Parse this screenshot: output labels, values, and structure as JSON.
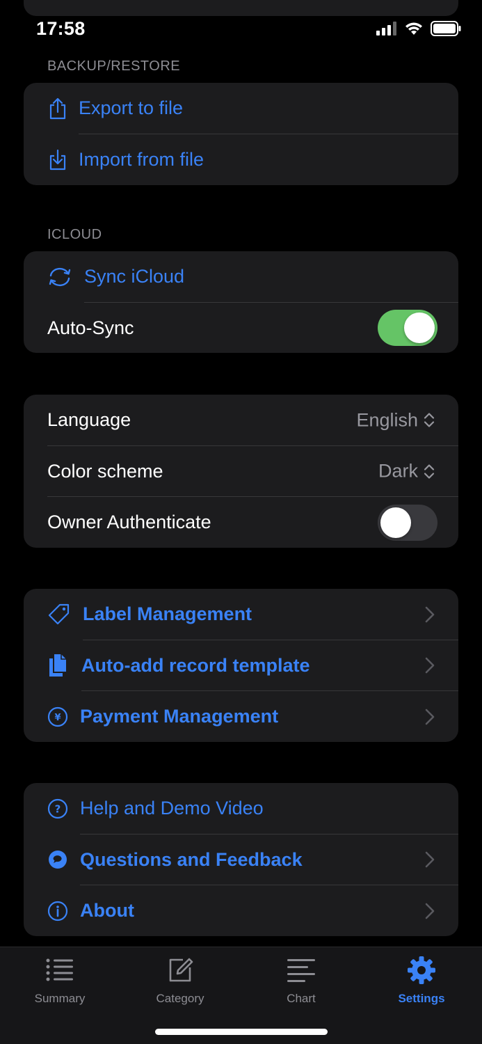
{
  "status_bar": {
    "time": "17:58"
  },
  "sections": {
    "backup": {
      "header": "BACKUP/RESTORE",
      "items": [
        {
          "label": "Export to file",
          "icon": "share-export-icon"
        },
        {
          "label": "Import from file",
          "icon": "import-tray-icon"
        }
      ]
    },
    "icloud": {
      "header": "ICLOUD",
      "sync_label": "Sync iCloud",
      "auto_sync_label": "Auto-Sync",
      "auto_sync_on": true
    },
    "preferences": {
      "language_label": "Language",
      "language_value": "English",
      "color_scheme_label": "Color scheme",
      "color_scheme_value": "Dark",
      "owner_auth_label": "Owner Authenticate",
      "owner_auth_on": false
    },
    "management": {
      "items": [
        {
          "label": "Label Management",
          "icon": "tag-icon"
        },
        {
          "label": "Auto-add record template",
          "icon": "documents-icon"
        },
        {
          "label": "Payment Management",
          "icon": "yen-circle-icon"
        }
      ]
    },
    "support": {
      "items": [
        {
          "label": "Help and Demo Video",
          "icon": "question-circle-icon"
        },
        {
          "label": "Questions and Feedback",
          "icon": "chat-bubble-icon"
        },
        {
          "label": "About",
          "icon": "info-circle-icon"
        }
      ]
    }
  },
  "tab_bar": {
    "tabs": [
      {
        "label": "Summary",
        "icon": "list-icon"
      },
      {
        "label": "Category",
        "icon": "edit-square-icon"
      },
      {
        "label": "Chart",
        "icon": "text-align-icon"
      },
      {
        "label": "Settings",
        "icon": "gear-icon"
      }
    ],
    "active": "Settings"
  },
  "colors": {
    "accent": "#3a82f6",
    "toggle_on": "#65c466",
    "group_bg": "#1c1c1e"
  }
}
